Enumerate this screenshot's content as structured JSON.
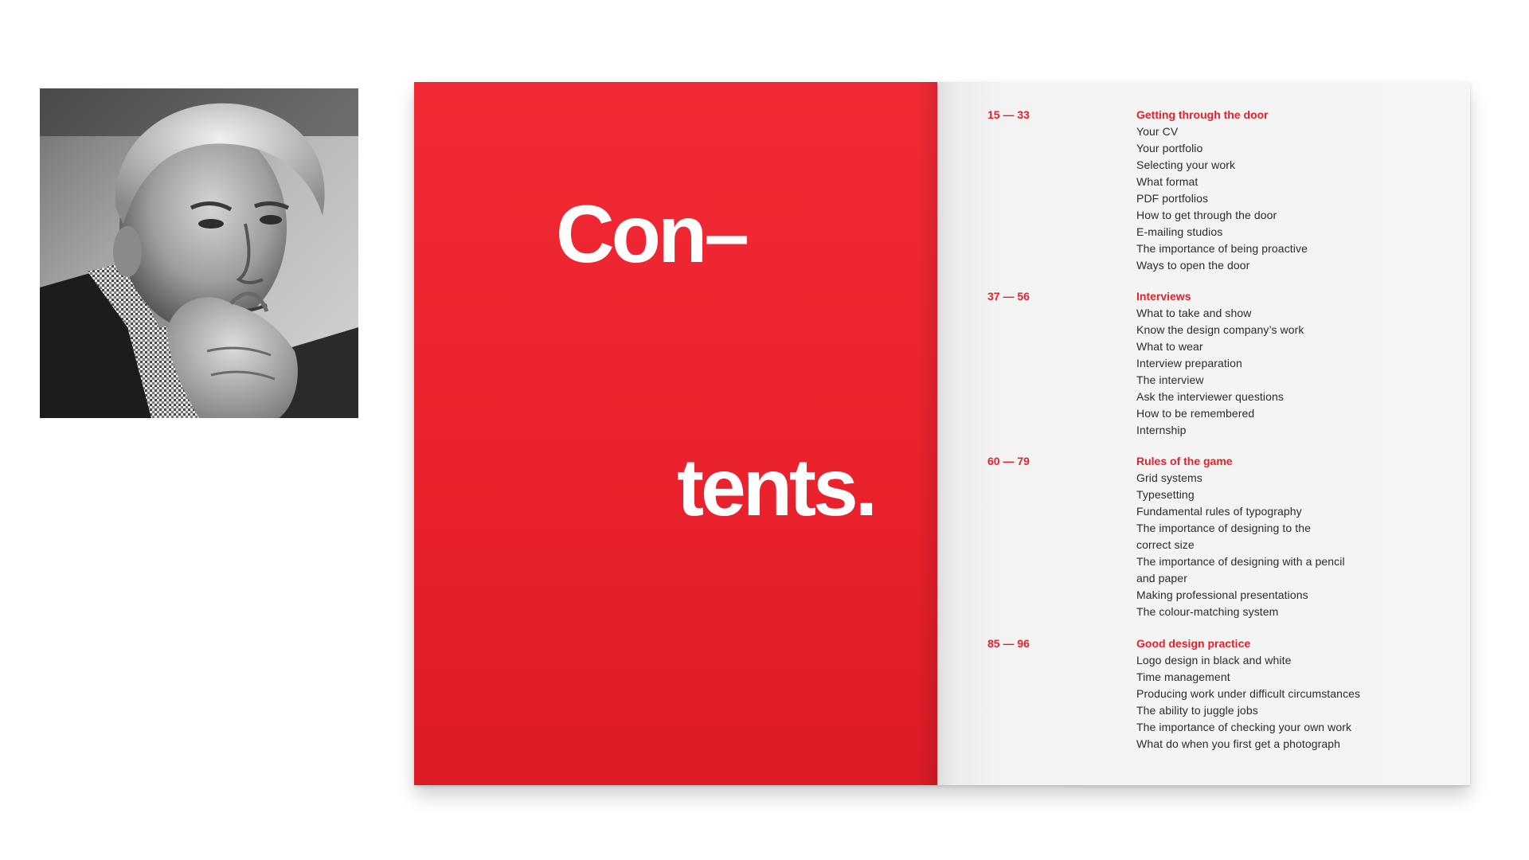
{
  "photo": {
    "alt": "Black and white portrait of an older man with hand to chin",
    "style": "grayscale"
  },
  "booklet": {
    "title_part_1": "Con–",
    "title_part_2": "tents.",
    "colors": {
      "accent_red": "#e3222c",
      "page_red": "#ee2530",
      "text_dark": "#2b2b2b",
      "page_white": "#f5f5f5"
    },
    "sections": [
      {
        "range": "15 — 33",
        "heading": "Getting through the door",
        "items": [
          "Your CV",
          "Your portfolio",
          "Selecting your work",
          "What format",
          "PDF portfolios",
          "How to get through the door",
          "E-mailing studios",
          "The importance of being proactive",
          "Ways to open the door"
        ]
      },
      {
        "range": "37 — 56",
        "heading": "Interviews",
        "items": [
          "What to take and show",
          "Know the design company’s work",
          "What to wear",
          "Interview preparation",
          "The interview",
          "Ask the interviewer questions",
          "How to be remembered",
          "Internship"
        ]
      },
      {
        "range": "60 — 79",
        "heading": "Rules of the game",
        "items": [
          "Grid systems",
          "Typesetting",
          "Fundamental rules of typography",
          "The importance of designing to the",
          "correct size",
          "The importance of designing with a pencil",
          "and paper",
          "Making professional presentations",
          "The colour-matching system"
        ]
      },
      {
        "range": "85 — 96",
        "heading": "Good design practice",
        "items": [
          "Logo design in black and white",
          "Time management",
          "Producing work under difficult circumstances",
          "The ability to juggle jobs",
          "The importance of checking your own work",
          "What do when you first get a photograph"
        ]
      }
    ]
  }
}
